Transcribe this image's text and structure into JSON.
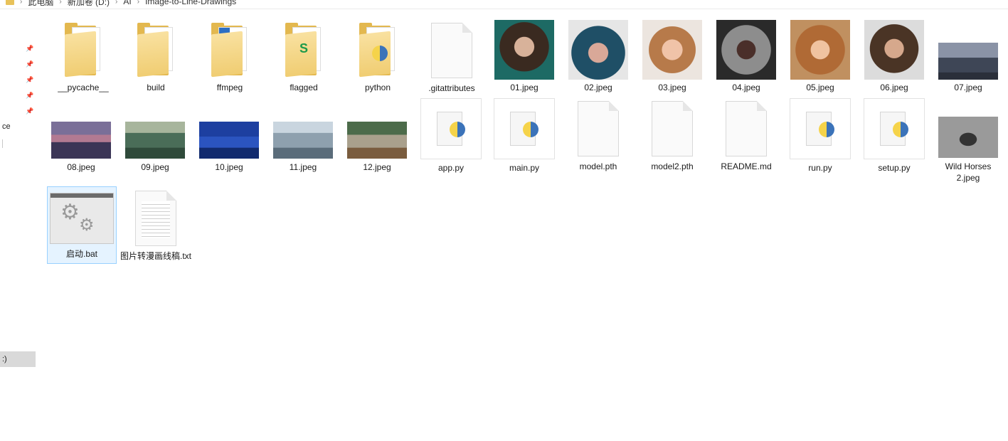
{
  "window": {
    "breadcrumb": [
      "此电脑",
      "新加卷 (D:)",
      "AI",
      "Image-to-Line-Drawings"
    ]
  },
  "nav": {
    "partial_label": "ce",
    "selected_partial": ":)"
  },
  "files": [
    {
      "name": "__pycache__",
      "type": "folder"
    },
    {
      "name": "build",
      "type": "folder"
    },
    {
      "name": "ffmpeg",
      "type": "folder"
    },
    {
      "name": "flagged",
      "type": "folder"
    },
    {
      "name": "python",
      "type": "folder"
    },
    {
      "name": ".gitattributes",
      "type": "file"
    },
    {
      "name": "01.jpeg",
      "type": "image"
    },
    {
      "name": "02.jpeg",
      "type": "image"
    },
    {
      "name": "03.jpeg",
      "type": "image"
    },
    {
      "name": "04.jpeg",
      "type": "image"
    },
    {
      "name": "05.jpeg",
      "type": "image"
    },
    {
      "name": "06.jpeg",
      "type": "image"
    },
    {
      "name": "07.jpeg",
      "type": "image"
    },
    {
      "name": "08.jpeg",
      "type": "image"
    },
    {
      "name": "09.jpeg",
      "type": "image"
    },
    {
      "name": "10.jpeg",
      "type": "image"
    },
    {
      "name": "11.jpeg",
      "type": "image"
    },
    {
      "name": "12.jpeg",
      "type": "image"
    },
    {
      "name": "app.py",
      "type": "python"
    },
    {
      "name": "main.py",
      "type": "python"
    },
    {
      "name": "model.pth",
      "type": "file"
    },
    {
      "name": "model2.pth",
      "type": "file"
    },
    {
      "name": "README.md",
      "type": "file"
    },
    {
      "name": "run.py",
      "type": "python"
    },
    {
      "name": "setup.py",
      "type": "python"
    },
    {
      "name": "Wild Horses 2.jpeg",
      "type": "image"
    },
    {
      "name": "启动.bat",
      "type": "batch",
      "selected": true
    },
    {
      "name": "图片转漫画线稿.txt",
      "type": "text"
    }
  ]
}
